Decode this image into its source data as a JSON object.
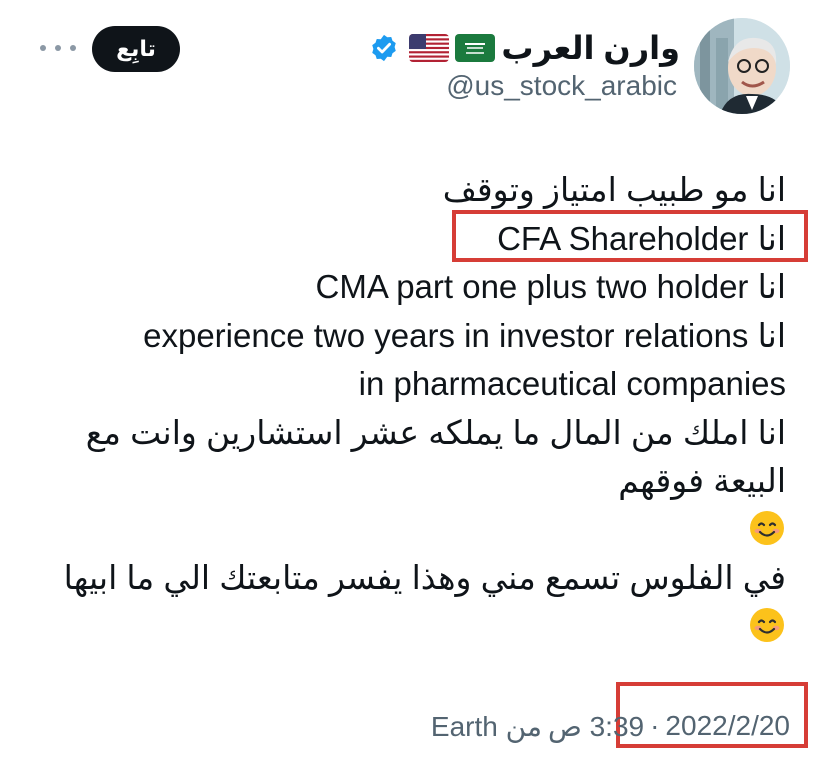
{
  "profile": {
    "display_name": "وارن العرب",
    "handle": "@us_stock_arabic",
    "verified_icon": "verified-badge-icon",
    "flags": [
      "saudi-flag-icon",
      "us-flag-icon"
    ]
  },
  "actions": {
    "follow_label": "تابِع",
    "more_icon": "more-options-icon"
  },
  "tweet": {
    "lines": [
      "انا مو طبيب امتياز وتوقف",
      "انا CFA Shareholder",
      "انا CMA part one plus two holder",
      "انا experience two years in investor relations",
      "in pharmaceutical companies",
      "انا املك من المال ما يملكه عشر استشارين وانت مع",
      "البيعة فوقهم",
      "في الفلوس تسمع مني وهذا يفسر متابعتك الي ما ابيها"
    ],
    "emoji": "smiling-face-icon"
  },
  "meta": {
    "time": "3:39 ص",
    "source": "من Earth",
    "separator": "·",
    "date": "2022/2/20"
  },
  "colors": {
    "text": "#0f1419",
    "secondary": "#536471",
    "verified": "#1d9bf0",
    "highlight": "#d63d36"
  }
}
